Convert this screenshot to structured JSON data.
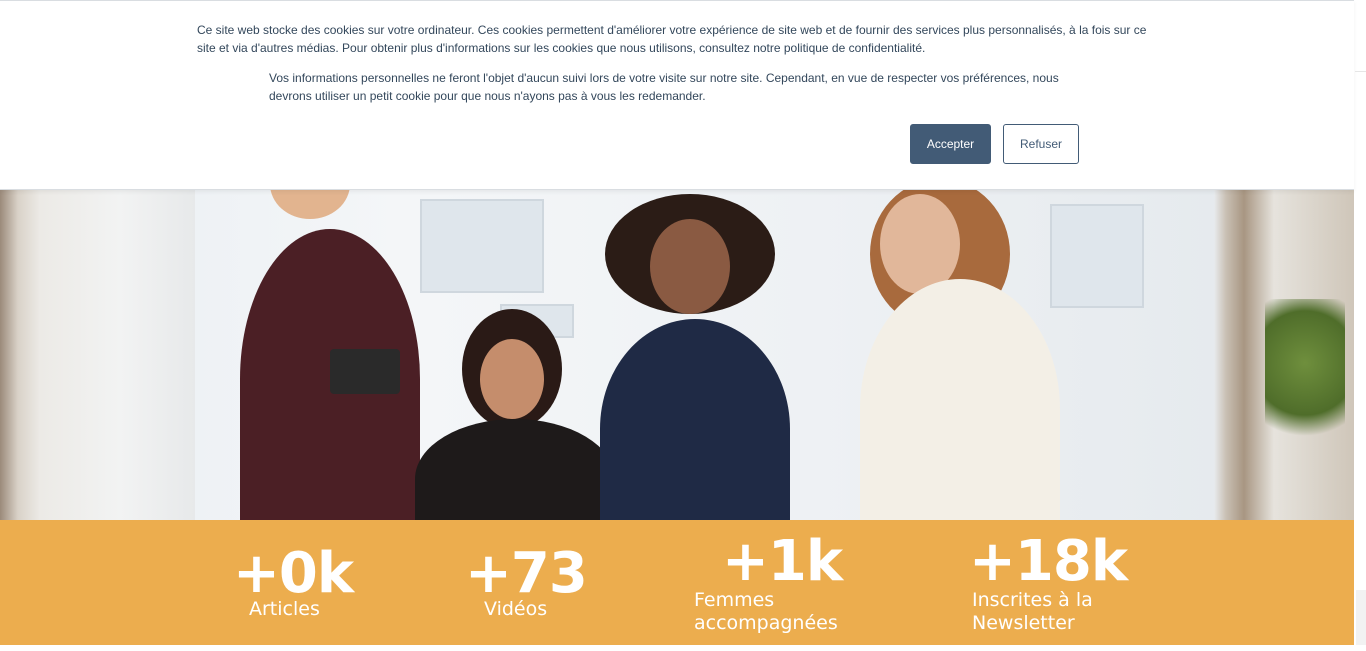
{
  "cookie_banner": {
    "text_main": "Ce site web stocke des cookies sur votre ordinateur. Ces cookies permettent d'améliorer votre expérience de site web et de fournir des services plus personnalisés, à la fois sur ce site et via d'autres médias. Pour obtenir plus d'informations sur les cookies que nous utilisons, consultez notre politique de confidentialité.",
    "text_secondary": "Vos informations personnelles ne feront l'objet d'aucun suivi lors de votre visite sur notre site. Cependant, en vue de respecter vos préférences, nous devrons utiliser un petit cookie pour que nous n'ayons pas à vous les redemander.",
    "accept_label": "Accepter",
    "refuse_label": "Refuser"
  },
  "stats": [
    {
      "value": "+0k",
      "label": "Articles"
    },
    {
      "value": "+73",
      "label": "Vidéos"
    },
    {
      "value": "+1k",
      "label": "Femmes accompagnées"
    },
    {
      "value": "+18k",
      "label": "Inscrites à la Newsletter"
    }
  ],
  "colors": {
    "stats_background": "#ecad4e",
    "accept_button": "#425b76",
    "banner_text": "#33475b"
  }
}
